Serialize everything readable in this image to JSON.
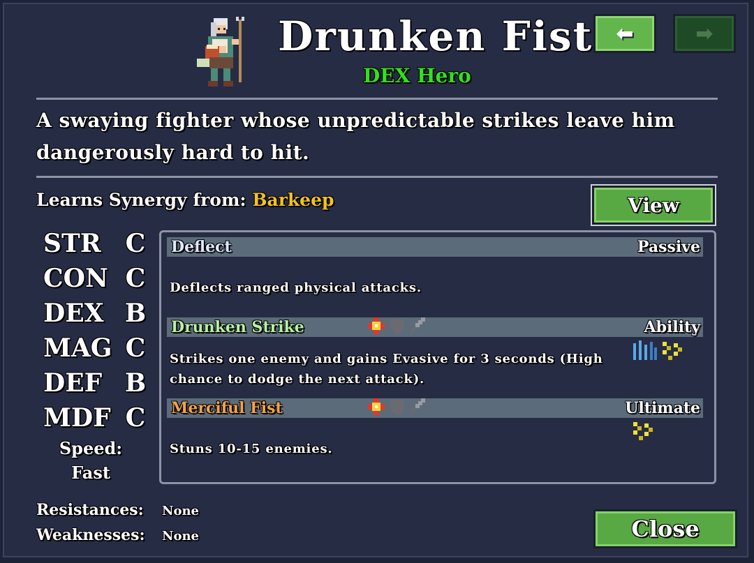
{
  "hero": {
    "name": "Drunken Fist",
    "class": "DEX Hero",
    "description": "A swaying fighter whose unpredictable strikes leave him dangerously hard to hit."
  },
  "nav": {
    "prev_icon": "arrow-left-icon",
    "next_icon": "arrow-right-icon",
    "prev_glyph": "⬅",
    "next_glyph": "➡"
  },
  "synergy": {
    "label": "Learns Synergy from:",
    "source": "Barkeep",
    "view_label": "View"
  },
  "stats": [
    {
      "name": "STR",
      "grade": "C"
    },
    {
      "name": "CON",
      "grade": "C"
    },
    {
      "name": "DEX",
      "grade": "B"
    },
    {
      "name": "MAG",
      "grade": "C"
    },
    {
      "name": "DEF",
      "grade": "B"
    },
    {
      "name": "MDF",
      "grade": "C"
    }
  ],
  "speed": {
    "label": "Speed:",
    "value": "Fast"
  },
  "resistances": {
    "label": "Resistances:",
    "value": "None"
  },
  "weaknesses": {
    "label": "Weaknesses:",
    "value": "None"
  },
  "abilities": [
    {
      "name": "Deflect",
      "type": "Passive",
      "name_color": "#dfe9ff",
      "description": "Deflects ranged physical attacks."
    },
    {
      "name": "Drunken Strike",
      "type": "Ability",
      "name_color": "#b8f0a4",
      "description": "Strikes one enemy and gains Evasive for 3 seconds (High chance to dodge the next attack).",
      "icons": [
        "burst-icon",
        "shield-icon",
        "sword-icon"
      ],
      "status_icons": [
        "evasive-icon",
        "stun-icon"
      ]
    },
    {
      "name": "Merciful Fist",
      "type": "Ultimate",
      "name_color": "#f4a24a",
      "description": "Stuns 10-15 enemies.",
      "icons": [
        "burst-icon",
        "shield-icon",
        "sword-icon"
      ],
      "status_icons": [
        "stun-icon"
      ]
    }
  ],
  "close_label": "Close",
  "colors": {
    "accent_green": "#34e01e",
    "gold": "#f4c21e",
    "button_green": "#58a843",
    "panel_bg": "#262c44"
  }
}
